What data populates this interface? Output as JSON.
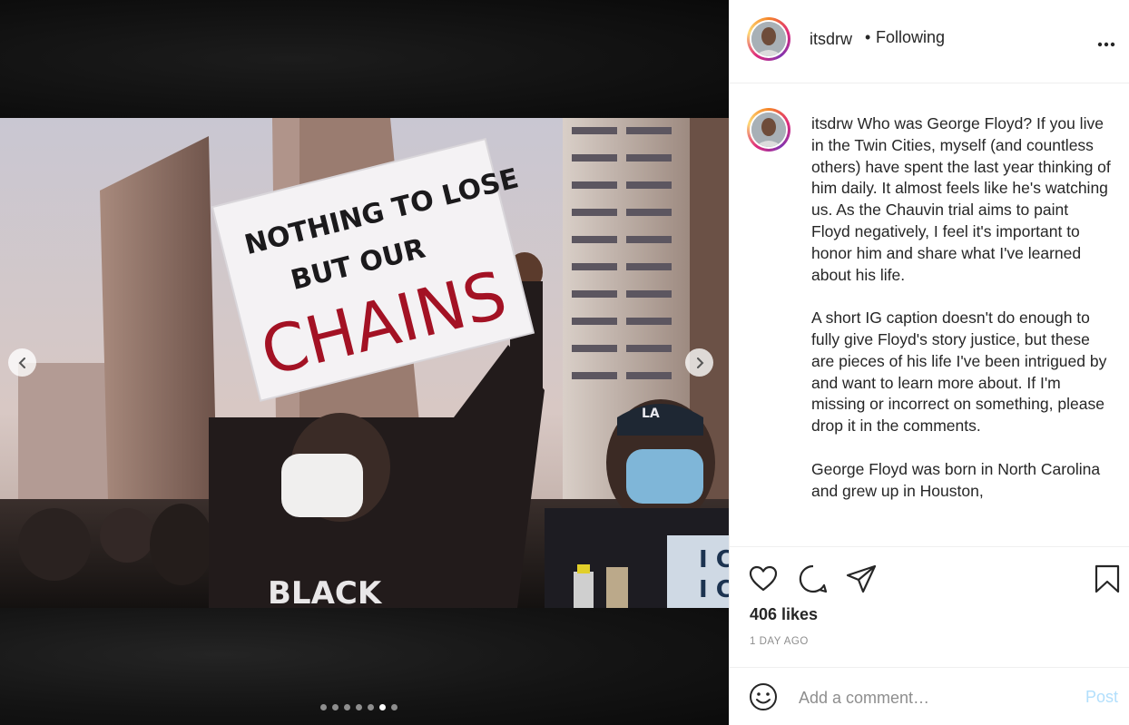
{
  "post": {
    "username": "itsdrw",
    "separator": "•",
    "follow_status": "Following",
    "more_icon": "more-horizontal-icon",
    "sign_text_line1": "NOTHING TO LOSE",
    "sign_text_line2": "BUT OUR",
    "sign_text_line3": "CHAINS",
    "shirt_text": "BLACK",
    "hat_text": "LA",
    "small_sign_text": "I CA",
    "small_sign_text2": "I CA",
    "carousel": {
      "count": 7,
      "active_index": 5
    }
  },
  "caption": {
    "username": "itsdrw",
    "text": " Who was George Floyd? If you live in the Twin Cities, myself (and countless others) have spent the last year thinking of him daily. It almost feels like he's watching us. As the Chauvin trial aims to paint Floyd negatively, I feel it's important to honor him and share what I've learned about his life.\n\nA short IG caption doesn't do enough to fully give Floyd's story justice, but these are pieces of his life I've been intrigued by and want to learn more about. If I'm missing or incorrect on something, please drop it in the comments.\n\nGeorge Floyd was born in North Carolina and grew up in Houston,"
  },
  "actions": {
    "likes": "406 likes",
    "time_ago": "1 DAY AGO"
  },
  "comment": {
    "placeholder": "Add a comment…",
    "post_label": "Post"
  },
  "colors": {
    "post_disabled": "#b2dffc",
    "muted": "#8e8e8e",
    "text": "#262626"
  }
}
